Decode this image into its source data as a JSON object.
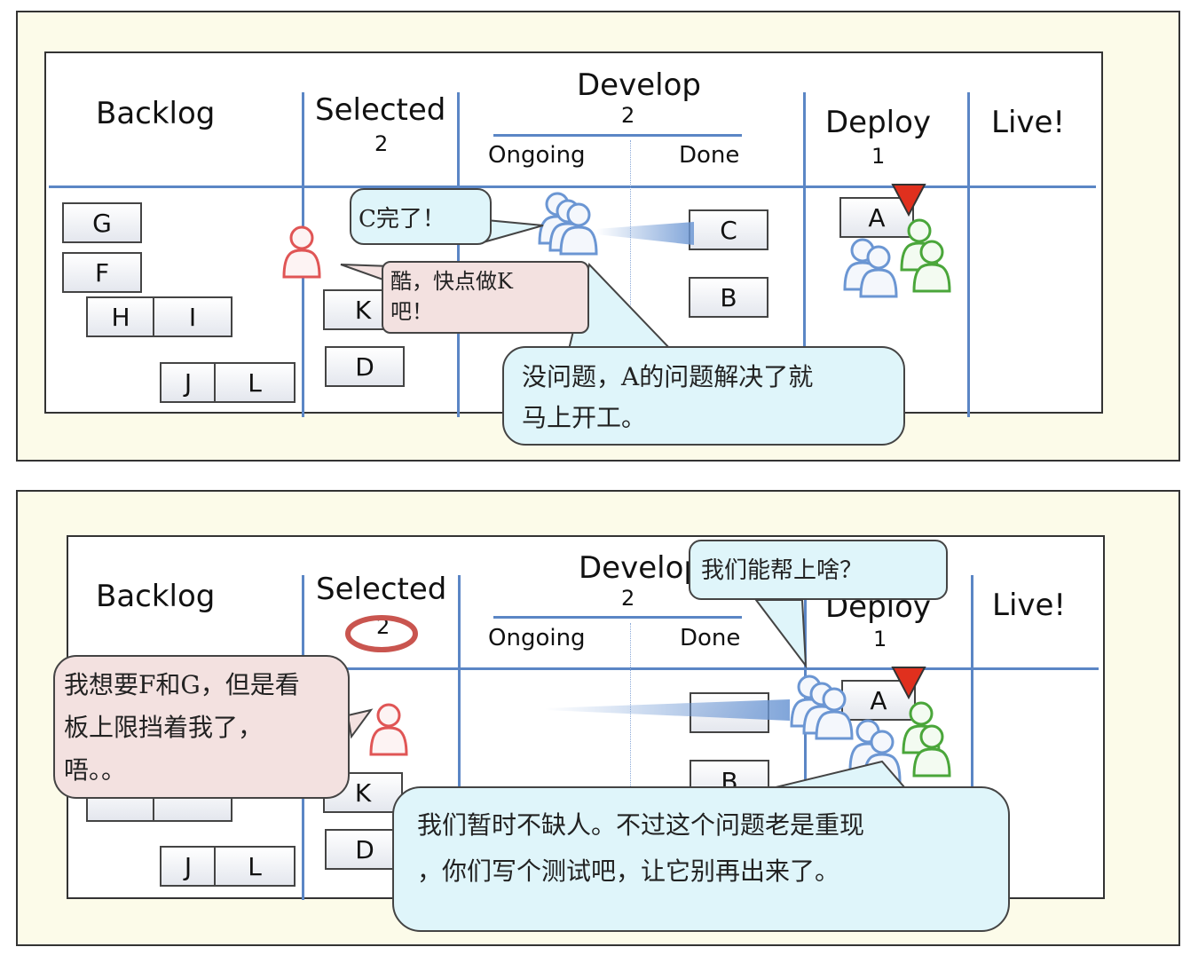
{
  "board_columns": {
    "backlog": "Backlog",
    "selected": "Selected",
    "develop": "Develop",
    "ongoing": "Ongoing",
    "done": "Done",
    "deploy": "Deploy",
    "live": "Live!"
  },
  "wip_limits": {
    "selected": "2",
    "develop": "2",
    "deploy": "1"
  },
  "panel1": {
    "cards": {
      "g": "G",
      "f": "F",
      "h": "H",
      "i": "I",
      "j": "J",
      "l": "L",
      "k": "K",
      "d": "D",
      "c": "C",
      "b": "B",
      "a": "A"
    },
    "bubbles": {
      "c_done": "C完了！",
      "do_k": "酷，快点做K\n吧！",
      "no_problem": "没问题，A的问题解决了就\n马上开工。"
    }
  },
  "panel2": {
    "cards": {
      "j": "J",
      "l": "L",
      "k": "K",
      "d": "D",
      "b": "B",
      "a": "A"
    },
    "bubbles": {
      "help": "我们能帮上啥？",
      "want_fg": "我想要F和G，但是看\n板上限挡着我了，\n唔。。",
      "write_test": "我们暂时不缺人。不过这个问题老是重现\n，你们写个测试吧，让它别再出来了。"
    }
  },
  "colors": {
    "grid_line": "#5b86c5",
    "bubble_blue": "#dff5fa",
    "bubble_pink": "#f3e1e0",
    "person_blue": "#6b96d3",
    "person_red": "#e05555",
    "person_green": "#4aa63a",
    "marker_red": "#e0301e"
  }
}
